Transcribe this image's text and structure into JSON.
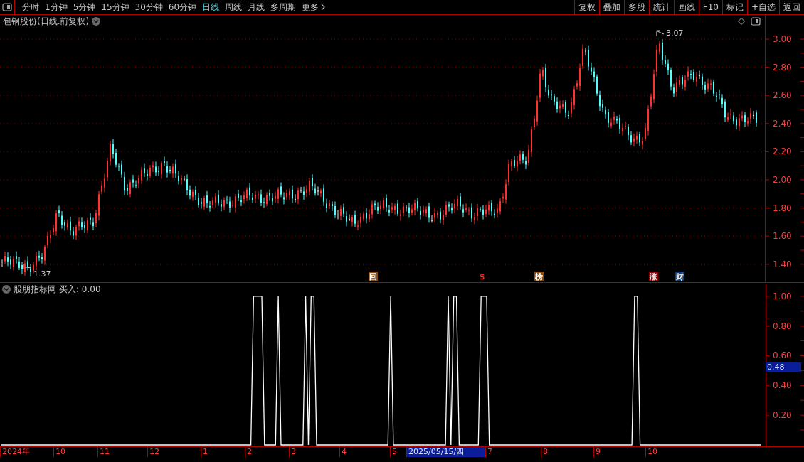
{
  "toolbar": {
    "periods": [
      {
        "label": "分时",
        "selected": false
      },
      {
        "label": "1分钟",
        "selected": false
      },
      {
        "label": "5分钟",
        "selected": false
      },
      {
        "label": "15分钟",
        "selected": false
      },
      {
        "label": "30分钟",
        "selected": false
      },
      {
        "label": "60分钟",
        "selected": false
      },
      {
        "label": "日线",
        "selected": true
      },
      {
        "label": "周线",
        "selected": false
      },
      {
        "label": "月线",
        "selected": false
      },
      {
        "label": "多周期",
        "selected": false
      },
      {
        "label": "更多",
        "selected": false,
        "kind": "more"
      }
    ],
    "buttons": [
      "复权",
      "叠加",
      "多股",
      "统计",
      "画线",
      "F10",
      "标记",
      "+自选",
      "返回"
    ]
  },
  "price_panel": {
    "title": "包钢股份(日线.前复权)",
    "axis_labels": [
      "3.00",
      "2.80",
      "2.60",
      "2.40",
      "2.20",
      "2.00",
      "1.80",
      "1.60",
      "1.40"
    ],
    "high_label": "3.07",
    "low_label": "1.37",
    "event_markers": [
      {
        "label": "回",
        "kind": "badge",
        "color": "#8a4a0c"
      },
      {
        "label": "$",
        "kind": "glyph",
        "color": "#ff2020"
      },
      {
        "label": "榜",
        "kind": "badge",
        "color": "#8a4a0c"
      },
      {
        "label": "涨",
        "kind": "badge",
        "color": "#8b0000"
      },
      {
        "label": "财",
        "kind": "badge",
        "color": "#0a3a78"
      }
    ]
  },
  "indicator_panel": {
    "name": "股朋指标网",
    "reading": "买入: 0.00",
    "current_value": "0.48",
    "chart_data": {
      "type": "line",
      "categories": [
        null,
        null,
        null,
        null,
        null,
        null,
        null,
        null,
        null,
        null,
        null,
        null,
        null,
        null,
        null,
        null,
        null,
        null,
        null,
        null,
        null,
        null,
        null,
        null,
        null,
        null,
        null,
        null,
        null,
        null,
        null,
        null,
        null,
        null,
        null,
        null,
        null,
        null,
        null,
        null,
        null,
        null,
        null,
        null,
        null,
        null,
        null,
        null,
        null,
        null,
        null,
        null,
        null,
        null,
        null,
        null,
        null,
        null,
        null,
        null,
        null,
        null,
        null,
        null,
        null,
        null,
        null,
        null,
        null,
        null,
        null,
        null,
        null,
        null,
        null,
        null,
        null,
        null,
        null,
        null,
        null,
        null,
        null,
        null,
        null,
        null,
        null,
        null,
        null,
        null,
        null,
        null,
        null,
        null,
        null,
        null,
        null,
        null,
        null,
        null,
        null,
        null,
        null,
        null,
        null,
        null,
        null,
        null,
        null,
        null,
        null,
        null,
        null,
        null,
        null,
        null,
        null,
        null,
        null,
        null,
        null,
        null,
        null,
        null,
        null,
        null,
        null,
        null,
        null,
        null,
        null,
        null,
        null,
        null,
        null,
        null,
        null,
        null,
        null,
        null,
        null,
        null,
        null,
        null,
        null,
        null,
        null,
        null,
        null,
        null,
        null,
        null,
        null,
        null,
        null,
        null,
        null,
        null,
        null,
        null,
        null,
        null,
        null,
        null,
        null,
        null,
        null,
        null,
        null,
        null,
        null,
        null,
        null,
        null,
        null,
        null,
        null,
        null,
        null,
        null,
        null,
        null,
        null,
        null,
        null,
        null,
        null,
        null,
        null,
        null,
        null,
        null,
        null,
        null,
        null,
        null,
        null,
        null,
        null,
        null,
        null,
        null,
        null,
        null,
        null,
        null,
        null,
        null,
        null,
        null,
        null,
        null,
        null,
        null,
        null,
        null,
        null,
        null,
        null,
        null,
        null,
        null,
        null,
        null,
        null,
        null,
        null,
        null,
        null,
        null,
        null,
        null,
        null,
        null,
        null,
        null,
        null,
        null,
        null,
        null,
        null,
        null,
        null,
        null,
        null,
        null,
        null,
        null,
        null,
        null,
        null,
        null,
        null,
        null,
        null,
        null,
        null,
        null,
        null,
        null,
        null,
        null,
        null,
        null,
        null,
        null,
        null,
        null,
        null,
        null,
        null,
        null,
        null,
        null,
        null,
        null,
        null,
        null
      ],
      "series": [
        {
          "color": "#ffffff",
          "values": [
            0,
            0,
            0,
            0,
            0,
            0,
            0,
            0,
            0,
            0,
            0,
            0,
            0,
            0,
            0,
            0,
            0,
            0,
            0,
            0,
            0,
            0,
            0,
            0,
            0,
            0,
            0,
            0,
            0,
            0,
            0,
            0,
            0,
            0,
            0,
            0,
            0,
            0,
            0,
            0,
            0,
            0,
            0,
            0,
            0,
            0,
            0,
            0,
            0,
            0,
            0,
            0,
            0,
            0,
            0,
            0,
            0,
            0,
            0,
            0,
            0,
            0,
            0,
            0,
            0,
            0,
            0,
            0,
            0,
            0,
            0,
            0,
            0,
            0,
            0,
            0,
            0,
            0,
            0,
            0,
            0,
            0,
            0,
            0,
            0,
            0,
            0,
            0,
            0,
            0,
            0,
            0,
            1,
            1,
            1,
            1,
            0,
            0,
            0,
            0,
            0,
            1,
            0,
            0,
            0,
            0,
            0,
            0,
            0,
            0,
            0,
            1,
            0,
            1,
            1,
            0,
            0,
            0,
            0,
            0,
            0,
            0,
            0,
            0,
            0,
            0,
            0,
            0,
            0,
            0,
            0,
            0,
            0,
            0,
            0,
            0,
            0,
            0,
            0,
            0,
            0,
            0,
            1,
            0,
            0,
            0,
            0,
            0,
            0,
            0,
            0,
            0,
            0,
            0,
            0,
            0,
            0,
            0,
            0,
            0,
            0,
            0,
            0,
            1,
            0,
            1,
            1,
            0,
            0,
            0,
            0,
            0,
            0,
            0,
            0,
            1,
            1,
            1,
            0,
            0,
            0,
            0,
            0,
            0,
            0,
            0,
            0,
            0,
            0,
            0,
            0,
            0,
            0,
            0,
            0,
            0,
            0,
            0,
            0,
            0,
            0,
            0,
            0,
            0,
            0,
            0,
            0,
            0,
            0,
            0,
            0,
            0,
            0,
            0,
            0,
            0,
            0,
            0,
            0,
            0,
            0,
            0,
            0,
            0,
            0,
            0,
            0,
            0,
            0,
            0,
            0,
            1,
            1,
            0,
            0,
            0,
            0,
            0,
            0,
            0,
            0,
            0,
            0,
            0,
            0,
            0,
            0,
            0,
            0,
            0,
            0,
            0,
            0,
            0,
            0,
            0,
            0,
            0,
            0,
            0,
            0,
            0,
            0,
            0,
            0,
            0,
            0,
            0,
            0,
            0,
            0,
            0,
            0,
            0,
            0,
            0,
            0,
            0
          ]
        }
      ],
      "ylim": [
        0,
        1.09
      ],
      "yticks": [
        {
          "value": 1,
          "label": "1.00"
        },
        {
          "value": 0.8,
          "label": "0.80"
        },
        {
          "value": 0.6,
          "label": "0.60"
        },
        {
          "value": 0.4,
          "label": "0.40"
        },
        {
          "value": 0.2,
          "label": "0.20"
        }
      ]
    }
  },
  "time_axis": [
    {
      "label": "2024年",
      "selected": false
    },
    {
      "label": "10",
      "selected": false
    },
    {
      "label": "11",
      "selected": false
    },
    {
      "label": "12",
      "selected": false
    },
    {
      "label": "1",
      "selected": false
    },
    {
      "label": "2",
      "selected": false
    },
    {
      "label": "3",
      "selected": false
    },
    {
      "label": "4",
      "selected": false
    },
    {
      "label": "5",
      "selected": false
    },
    {
      "label": "2025/05/15/四",
      "selected": true
    },
    {
      "label": "7",
      "selected": false
    },
    {
      "label": "8",
      "selected": false
    },
    {
      "label": "9",
      "selected": false
    },
    {
      "label": "10",
      "selected": false
    }
  ]
}
